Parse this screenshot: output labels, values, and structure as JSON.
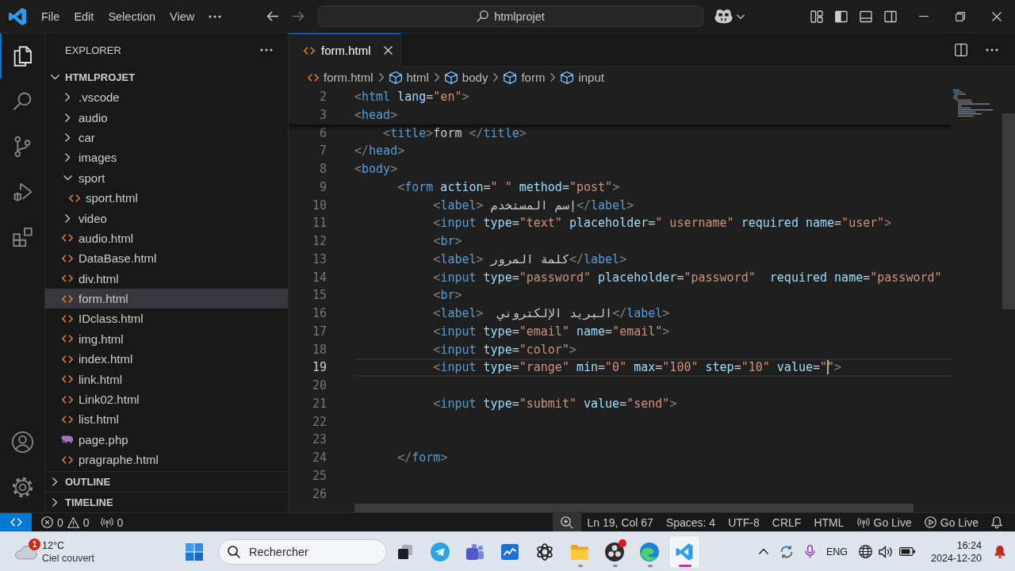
{
  "title_bar": {
    "menus": [
      "File",
      "Edit",
      "Selection",
      "View"
    ],
    "navigation": [
      {
        "kind": "back",
        "disabled": false
      },
      {
        "kind": "forward",
        "disabled": true
      }
    ],
    "search": "htmlprojet",
    "layout_buttons": [
      {
        "kind": "customize",
        "on": false
      },
      {
        "kind": "sidebar",
        "on": true
      },
      {
        "kind": "panel",
        "on": false
      },
      {
        "kind": "secondary",
        "on": false
      }
    ]
  },
  "activity_bar": {
    "items": [
      {
        "kind": "explorer",
        "selected": true
      },
      {
        "kind": "search",
        "selected": false
      },
      {
        "kind": "scm",
        "selected": false
      },
      {
        "kind": "debug",
        "selected": false
      },
      {
        "kind": "extensions",
        "selected": false
      }
    ],
    "bottom": [
      {
        "kind": "account"
      },
      {
        "kind": "settings"
      }
    ]
  },
  "sidebar": {
    "title": "EXPLORER",
    "project": {
      "name": "HTMLPROJET",
      "expanded": true
    },
    "items": [
      {
        "label": ".vscode",
        "kind": "folder",
        "expanded": false,
        "selected": false
      },
      {
        "label": "audio",
        "kind": "folder",
        "expanded": false,
        "selected": false
      },
      {
        "label": "car",
        "kind": "folder",
        "expanded": false,
        "selected": false
      },
      {
        "label": "images",
        "kind": "folder",
        "expanded": false,
        "selected": false
      },
      {
        "label": "sport",
        "kind": "folder",
        "expanded": true,
        "selected": false,
        "children": [
          {
            "label": "sport.html",
            "kind": "html",
            "selected": false
          }
        ]
      },
      {
        "label": "video",
        "kind": "folder",
        "expanded": false,
        "selected": false
      },
      {
        "label": "audio.html",
        "kind": "html",
        "selected": false
      },
      {
        "label": "DataBase.html",
        "kind": "html",
        "selected": false
      },
      {
        "label": "div.html",
        "kind": "html",
        "selected": false
      },
      {
        "label": "form.html",
        "kind": "html",
        "selected": true
      },
      {
        "label": "IDclass.html",
        "kind": "html",
        "selected": false
      },
      {
        "label": "img.html",
        "kind": "html",
        "selected": false
      },
      {
        "label": "index.html",
        "kind": "html",
        "selected": false
      },
      {
        "label": "link.html",
        "kind": "html",
        "selected": false
      },
      {
        "label": "Link02.html",
        "kind": "html",
        "selected": false
      },
      {
        "label": "list.html",
        "kind": "html",
        "selected": false
      },
      {
        "label": "page.php",
        "kind": "php",
        "selected": false
      },
      {
        "label": "pragraphe.html",
        "kind": "html",
        "selected": false
      }
    ],
    "sections": [
      {
        "name": "OUTLINE",
        "expanded": false
      },
      {
        "name": "TIMELINE",
        "expanded": false
      }
    ]
  },
  "editor": {
    "tabs": [
      {
        "label": "form.html",
        "kind": "html",
        "selected": true
      }
    ],
    "breadcrumbs": [
      {
        "kind": "file",
        "label": "form.html"
      },
      {
        "kind": "element",
        "label": "html"
      },
      {
        "kind": "element",
        "label": "body"
      },
      {
        "kind": "element",
        "label": "form"
      },
      {
        "kind": "element",
        "label": "input"
      }
    ],
    "sticky_lines": [
      {
        "number": "2",
        "tokens": [
          {
            "kind": "punct",
            "text": "<"
          },
          {
            "kind": "tag",
            "text": "html"
          },
          {
            "kind": "attr",
            "text": " lang"
          },
          {
            "kind": "plain",
            "text": "="
          },
          {
            "kind": "string",
            "text": "\"en\""
          },
          {
            "kind": "punct",
            "text": ">"
          }
        ]
      },
      {
        "number": "3",
        "tokens": [
          {
            "kind": "punct",
            "text": "<"
          },
          {
            "kind": "tag",
            "text": "head"
          },
          {
            "kind": "punct",
            "text": ">"
          }
        ]
      }
    ],
    "lines": [
      {
        "number": "6",
        "current": false,
        "tokens": [
          {
            "kind": "punct",
            "text": "    <"
          },
          {
            "kind": "tag",
            "text": "title"
          },
          {
            "kind": "punct",
            "text": ">"
          },
          {
            "kind": "plain",
            "text": "form "
          },
          {
            "kind": "punct",
            "text": "</"
          },
          {
            "kind": "tag",
            "text": "title"
          },
          {
            "kind": "punct",
            "text": ">"
          }
        ]
      },
      {
        "number": "7",
        "current": false,
        "tokens": [
          {
            "kind": "punct",
            "text": "</"
          },
          {
            "kind": "tag",
            "text": "head"
          },
          {
            "kind": "punct",
            "text": ">"
          }
        ]
      },
      {
        "number": "8",
        "current": false,
        "tokens": [
          {
            "kind": "punct",
            "text": "<"
          },
          {
            "kind": "tag",
            "text": "body"
          },
          {
            "kind": "punct",
            "text": ">"
          }
        ]
      },
      {
        "number": "9",
        "current": false,
        "tokens": [
          {
            "kind": "punct",
            "text": "      <"
          },
          {
            "kind": "tag",
            "text": "form"
          },
          {
            "kind": "attr",
            "text": " action"
          },
          {
            "kind": "plain",
            "text": "="
          },
          {
            "kind": "string",
            "text": "\" \""
          },
          {
            "kind": "attr",
            "text": " method"
          },
          {
            "kind": "plain",
            "text": "="
          },
          {
            "kind": "string",
            "text": "\"post\""
          },
          {
            "kind": "punct",
            "text": ">"
          }
        ]
      },
      {
        "number": "10",
        "current": false,
        "tokens": [
          {
            "kind": "punct",
            "text": "           <"
          },
          {
            "kind": "tag",
            "text": "label"
          },
          {
            "kind": "punct",
            "text": ">"
          },
          {
            "kind": "plain",
            "text": " إسم المستخدم"
          },
          {
            "kind": "punct",
            "text": "</"
          },
          {
            "kind": "tag",
            "text": "label"
          },
          {
            "kind": "punct",
            "text": ">"
          }
        ]
      },
      {
        "number": "11",
        "current": false,
        "tokens": [
          {
            "kind": "punct",
            "text": "           <"
          },
          {
            "kind": "tag",
            "text": "input"
          },
          {
            "kind": "attr",
            "text": " type"
          },
          {
            "kind": "plain",
            "text": "="
          },
          {
            "kind": "string",
            "text": "\"text\""
          },
          {
            "kind": "attr",
            "text": " placeholder"
          },
          {
            "kind": "plain",
            "text": "="
          },
          {
            "kind": "string",
            "text": "\" username\""
          },
          {
            "kind": "attr",
            "text": " required"
          },
          {
            "kind": "attr",
            "text": " name"
          },
          {
            "kind": "plain",
            "text": "="
          },
          {
            "kind": "string",
            "text": "\"user\""
          },
          {
            "kind": "punct",
            "text": ">"
          }
        ]
      },
      {
        "number": "12",
        "current": false,
        "tokens": [
          {
            "kind": "punct",
            "text": "           <"
          },
          {
            "kind": "tag",
            "text": "br"
          },
          {
            "kind": "punct",
            "text": ">"
          }
        ]
      },
      {
        "number": "13",
        "current": false,
        "tokens": [
          {
            "kind": "punct",
            "text": "           <"
          },
          {
            "kind": "tag",
            "text": "label"
          },
          {
            "kind": "punct",
            "text": ">"
          },
          {
            "kind": "plain",
            "text": " كلمة المرور"
          },
          {
            "kind": "punct",
            "text": "</"
          },
          {
            "kind": "tag",
            "text": "label"
          },
          {
            "kind": "punct",
            "text": ">"
          }
        ]
      },
      {
        "number": "14",
        "current": false,
        "tokens": [
          {
            "kind": "punct",
            "text": "           <"
          },
          {
            "kind": "tag",
            "text": "input"
          },
          {
            "kind": "attr",
            "text": " type"
          },
          {
            "kind": "plain",
            "text": "="
          },
          {
            "kind": "string",
            "text": "\"password\""
          },
          {
            "kind": "attr",
            "text": " placeholder"
          },
          {
            "kind": "plain",
            "text": "="
          },
          {
            "kind": "string",
            "text": "\"password\""
          },
          {
            "kind": "attr",
            "text": "  required"
          },
          {
            "kind": "attr",
            "text": " name"
          },
          {
            "kind": "plain",
            "text": "="
          },
          {
            "kind": "string",
            "text": "\"password\""
          }
        ]
      },
      {
        "number": "15",
        "current": false,
        "tokens": [
          {
            "kind": "punct",
            "text": "           <"
          },
          {
            "kind": "tag",
            "text": "br"
          },
          {
            "kind": "punct",
            "text": ">"
          }
        ]
      },
      {
        "number": "16",
        "current": false,
        "tokens": [
          {
            "kind": "punct",
            "text": "           <"
          },
          {
            "kind": "tag",
            "text": "label"
          },
          {
            "kind": "punct",
            "text": ">"
          },
          {
            "kind": "plain",
            "text": "  البريد الإلكتروني"
          },
          {
            "kind": "punct",
            "text": "</"
          },
          {
            "kind": "tag",
            "text": "label"
          },
          {
            "kind": "punct",
            "text": ">"
          }
        ]
      },
      {
        "number": "17",
        "current": false,
        "tokens": [
          {
            "kind": "punct",
            "text": "           <"
          },
          {
            "kind": "tag",
            "text": "input"
          },
          {
            "kind": "attr",
            "text": " type"
          },
          {
            "kind": "plain",
            "text": "="
          },
          {
            "kind": "string",
            "text": "\"email\""
          },
          {
            "kind": "attr",
            "text": " name"
          },
          {
            "kind": "plain",
            "text": "="
          },
          {
            "kind": "string",
            "text": "\"email\""
          },
          {
            "kind": "punct",
            "text": ">"
          }
        ]
      },
      {
        "number": "18",
        "current": false,
        "tokens": [
          {
            "kind": "punct",
            "text": "           <"
          },
          {
            "kind": "tag",
            "text": "input"
          },
          {
            "kind": "attr",
            "text": " type"
          },
          {
            "kind": "plain",
            "text": "="
          },
          {
            "kind": "string",
            "text": "\"color\""
          },
          {
            "kind": "punct",
            "text": ">"
          }
        ]
      },
      {
        "number": "19",
        "current": true,
        "tokens": [
          {
            "kind": "punct",
            "text": "           <"
          },
          {
            "kind": "tag",
            "text": "input"
          },
          {
            "kind": "attr",
            "text": " type"
          },
          {
            "kind": "plain",
            "text": "="
          },
          {
            "kind": "string",
            "text": "\"range\""
          },
          {
            "kind": "attr",
            "text": " min"
          },
          {
            "kind": "plain",
            "text": "="
          },
          {
            "kind": "string",
            "text": "\"0\""
          },
          {
            "kind": "attr",
            "text": " max"
          },
          {
            "kind": "plain",
            "text": "="
          },
          {
            "kind": "string",
            "text": "\"100\""
          },
          {
            "kind": "attr",
            "text": " step"
          },
          {
            "kind": "plain",
            "text": "="
          },
          {
            "kind": "string",
            "text": "\"10\""
          },
          {
            "kind": "attr",
            "text": " value"
          },
          {
            "kind": "plain",
            "text": "="
          },
          {
            "kind": "string",
            "text": "\""
          },
          {
            "kind": "cursor"
          },
          {
            "kind": "string",
            "text": "\""
          },
          {
            "kind": "punct",
            "text": ">"
          }
        ]
      },
      {
        "number": "20",
        "current": false
      },
      {
        "number": "21",
        "current": false,
        "tokens": [
          {
            "kind": "punct",
            "text": "           <"
          },
          {
            "kind": "tag",
            "text": "input"
          },
          {
            "kind": "attr",
            "text": " type"
          },
          {
            "kind": "plain",
            "text": "="
          },
          {
            "kind": "string",
            "text": "\"submit\""
          },
          {
            "kind": "attr",
            "text": " value"
          },
          {
            "kind": "plain",
            "text": "="
          },
          {
            "kind": "string",
            "text": "\"send\""
          },
          {
            "kind": "punct",
            "text": ">"
          }
        ]
      },
      {
        "number": "22",
        "current": false
      },
      {
        "number": "23",
        "current": false
      },
      {
        "number": "24",
        "current": false,
        "tokens": [
          {
            "kind": "punct",
            "text": "      </"
          },
          {
            "kind": "tag",
            "text": "form"
          },
          {
            "kind": "punct",
            "text": ">"
          }
        ]
      },
      {
        "number": "25",
        "current": false
      },
      {
        "number": "26",
        "current": false
      }
    ]
  },
  "status_bar": {
    "problems": {
      "errors": "0",
      "warnings": "0"
    },
    "ports": "0",
    "items": [
      {
        "kind": "zoom",
        "highlighted": true
      },
      {
        "kind": "text",
        "label": "Ln 19, Col 67",
        "highlighted": false
      },
      {
        "kind": "text",
        "label": "Spaces: 4",
        "highlighted": false
      },
      {
        "kind": "text",
        "label": "UTF-8",
        "highlighted": false
      },
      {
        "kind": "text",
        "label": "CRLF",
        "highlighted": false
      },
      {
        "kind": "text",
        "label": "HTML",
        "highlighted": false
      },
      {
        "kind": "broadcast",
        "label": "Go Live",
        "highlighted": false
      },
      {
        "kind": "play",
        "label": "Go Live",
        "highlighted": false
      },
      {
        "kind": "bell",
        "highlighted": false
      }
    ]
  },
  "taskbar": {
    "weather": {
      "badge": "1",
      "temperature": "12°C",
      "condition": "Ciel couvert"
    },
    "search": {
      "placeholder": "Rechercher"
    },
    "apps": [
      {
        "kind": "taskview",
        "running": false,
        "selected": false,
        "alert": false
      },
      {
        "kind": "plane",
        "running": false,
        "selected": false,
        "alert": false
      },
      {
        "kind": "tiles",
        "running": false,
        "selected": false,
        "alert": false
      },
      {
        "kind": "board",
        "running": false,
        "selected": false,
        "alert": false
      },
      {
        "kind": "knot",
        "running": false,
        "selected": false,
        "alert": false
      },
      {
        "kind": "folder",
        "running": true,
        "selected": false,
        "alert": false
      },
      {
        "kind": "disc",
        "running": true,
        "selected": false,
        "alert": true
      },
      {
        "kind": "swirl",
        "running": true,
        "selected": false,
        "alert": false
      },
      {
        "kind": "ribbon",
        "running": true,
        "selected": true,
        "alert": false
      }
    ],
    "tray": {
      "language": "ENG",
      "time": "16:24",
      "date": "2024-12-20"
    }
  }
}
